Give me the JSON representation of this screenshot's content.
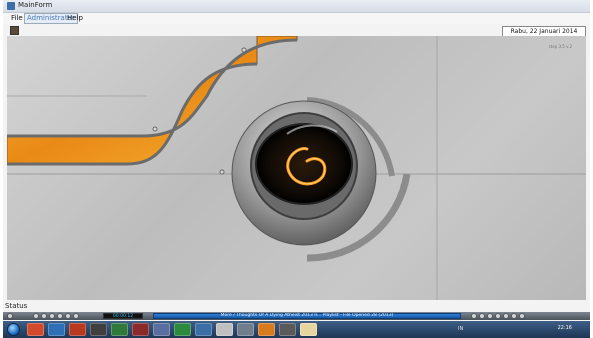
{
  "window": {
    "title": "MainForm"
  },
  "menubar": {
    "items": [
      "File",
      "Administrator",
      "Help"
    ],
    "active_item": "Administrator",
    "datetime": "Rabu, 22 Januari 2014 (22:16:30)"
  },
  "canvas": {
    "corner_label": "step 3.5 v.2"
  },
  "status": {
    "text": "Status"
  },
  "player": {
    "time": "00:00:12",
    "now_playing": "More / Thoughts Of A Dying Atheist  2013 II... Playlist - File Opened 28 (2013)"
  },
  "taskbar": {
    "lang": "IN",
    "clock": "22:16",
    "colors": {
      "accent": "#1f6fc4",
      "lens_orange": "#ff9a1a",
      "panel_orange": "#f29a1f"
    }
  }
}
